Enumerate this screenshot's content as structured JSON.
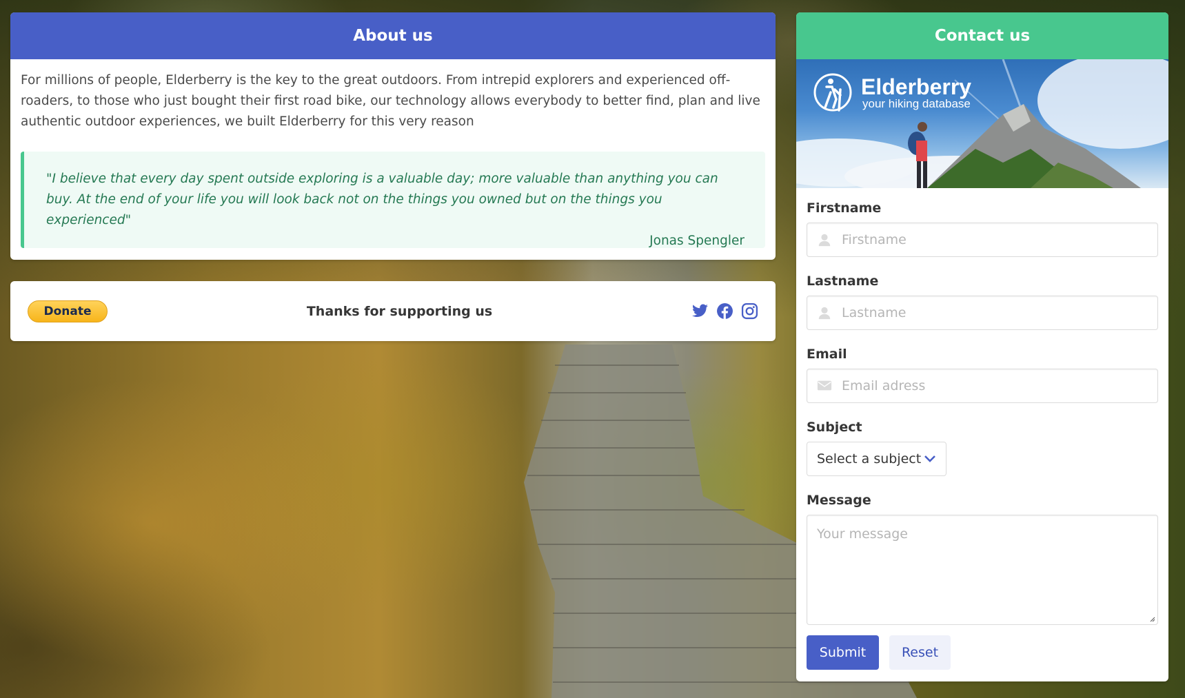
{
  "about": {
    "title": "About us",
    "text": "For millions of people, Elderberry is the key to the great outdoors. From intrepid explorers and experienced off-roaders, to those who just bought their first road bike, our technology allows everybody to better find, plan and live authentic outdoor experiences, we built Elderberry for this very reason",
    "quote": "\"I believe that every day spent outside exploring is a valuable day; more valuable than anything you can buy. At the end of your life you will look back not on the things you owned but on the things you experienced\"",
    "quote_author": "Jonas Spengler"
  },
  "support": {
    "donate_label": "Donate",
    "thanks_text": "Thanks for supporting us",
    "social_icons": [
      "twitter-icon",
      "facebook-icon",
      "instagram-icon"
    ]
  },
  "contact": {
    "title": "Contact us",
    "banner": {
      "brand": "Elderberry",
      "tagline": "your hiking database"
    },
    "fields": {
      "firstname": {
        "label": "Firstname",
        "placeholder": "Firstname",
        "icon": "user-icon"
      },
      "lastname": {
        "label": "Lastname",
        "placeholder": "Lastname",
        "icon": "user-icon"
      },
      "email": {
        "label": "Email",
        "placeholder": "Email adress",
        "icon": "envelope-icon"
      },
      "subject": {
        "label": "Subject",
        "selected": "Select a subject"
      },
      "message": {
        "label": "Message",
        "placeholder": "Your message"
      }
    },
    "submit_label": "Submit",
    "reset_label": "Reset"
  },
  "colors": {
    "primary": "#485fc7",
    "success": "#48c78e",
    "quote_bg": "#effaf5",
    "quote_text": "#257953"
  }
}
